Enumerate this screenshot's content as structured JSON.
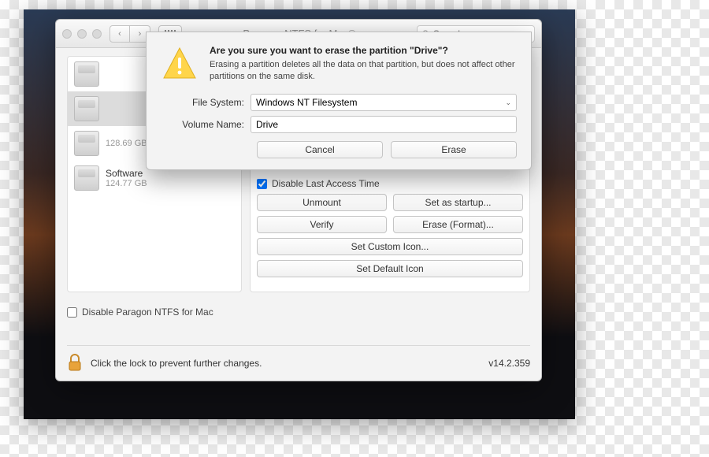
{
  "window": {
    "title": "Paragon NTFS for Mac®",
    "search_placeholder": "Search"
  },
  "sidebar": {
    "devices": [
      {
        "name": "",
        "size": ""
      },
      {
        "name": "",
        "size": ""
      },
      {
        "name": "",
        "size": "128.69 GB"
      },
      {
        "name": "Software",
        "size": "124.77 GB"
      }
    ]
  },
  "main": {
    "disable_last_access": "Disable Last Access Time",
    "buttons": {
      "unmount": "Unmount",
      "set_startup": "Set as startup...",
      "verify": "Verify",
      "erase_format": "Erase (Format)...",
      "custom_icon": "Set Custom Icon...",
      "default_icon": "Set Default Icon"
    }
  },
  "disable_paragon": "Disable Paragon NTFS for Mac",
  "footer": {
    "lock_text": "Click the lock to prevent further changes.",
    "version": "v14.2.359"
  },
  "dialog": {
    "title": "Are you sure you want to erase the partition \"Drive\"?",
    "subtitle": "Erasing a partition deletes all the data on that partition, but does not affect other partitions on the same disk.",
    "fs_label": "File System:",
    "fs_value": "Windows NT Filesystem",
    "vol_label": "Volume Name:",
    "vol_value": "Drive",
    "cancel": "Cancel",
    "erase": "Erase"
  }
}
